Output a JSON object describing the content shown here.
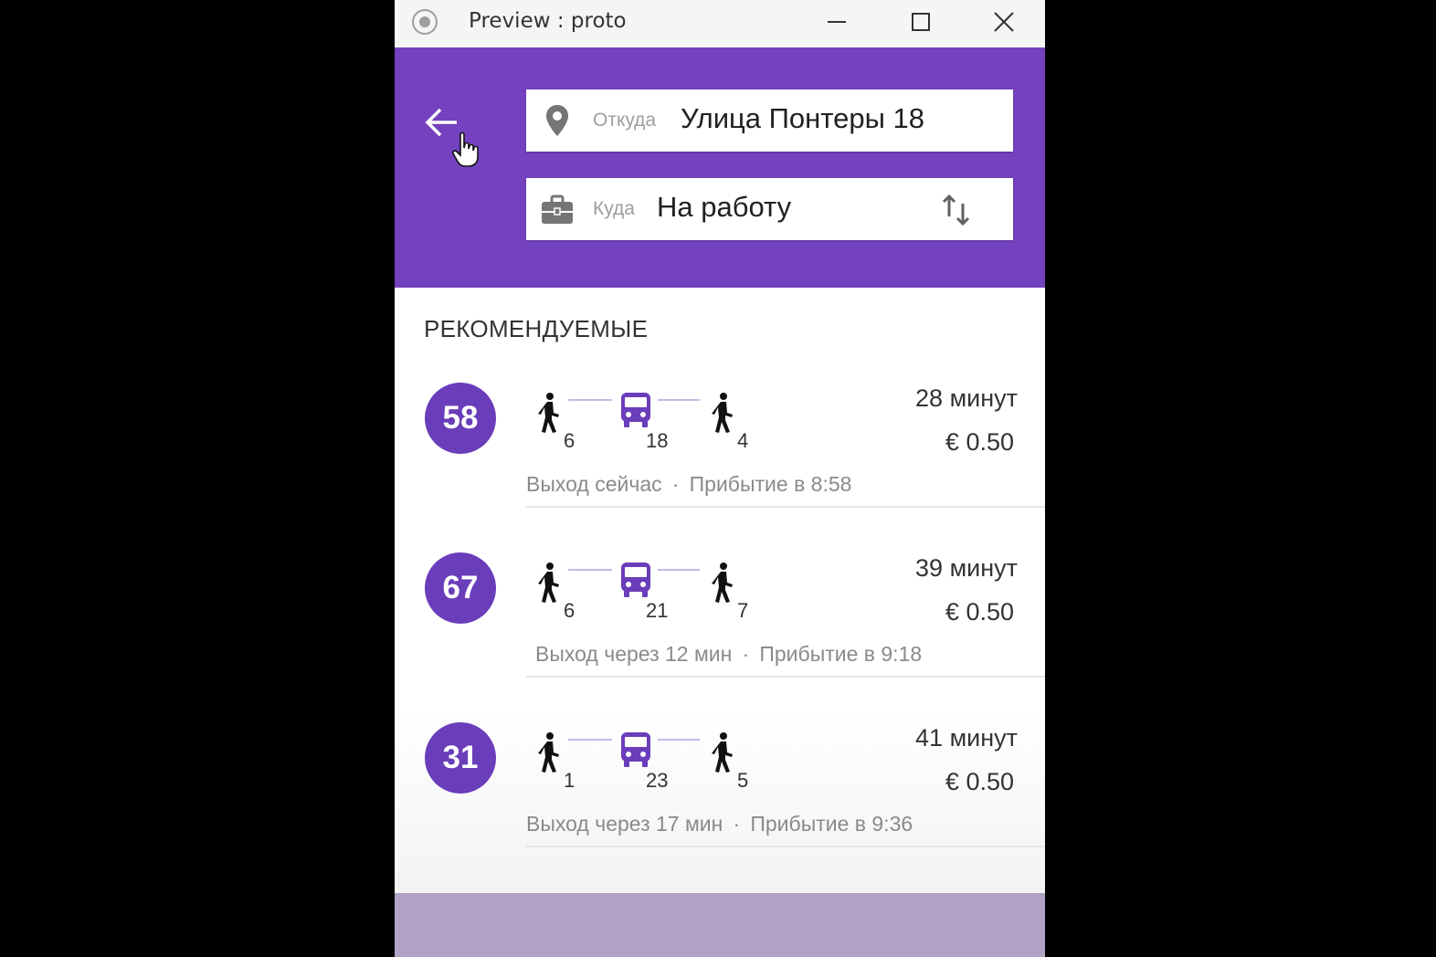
{
  "window": {
    "title": "Preview : proto"
  },
  "search": {
    "from_label": "Откуда",
    "from_value": "Улица Понтеры 18",
    "to_label": "Куда",
    "to_value": "На работу"
  },
  "section_title": "РЕКОМЕНДУЕМЫЕ",
  "routes": [
    {
      "number": "58",
      "walk_before": "6",
      "bus_ride": "18",
      "walk_after": "4",
      "duration": "28 минут",
      "price": "€ 0.50",
      "departure": "Выход сейчас",
      "separator": "·",
      "arrival": "Прибытие в 8:58"
    },
    {
      "number": "67",
      "walk_before": "6",
      "bus_ride": "21",
      "walk_after": "7",
      "duration": "39 минут",
      "price": "€ 0.50",
      "departure": "Выход через 12 мин",
      "separator": "·",
      "arrival": "Прибытие в 9:18"
    },
    {
      "number": "31",
      "walk_before": "1",
      "bus_ride": "23",
      "walk_after": "5",
      "duration": "41 минут",
      "price": "€ 0.50",
      "departure": "Выход через 17 мин",
      "separator": "·",
      "arrival": "Прибытие в 9:36"
    }
  ],
  "colors": {
    "header": "#7442bf",
    "badge": "#6a3dba",
    "bus_icon": "#6a3dba",
    "bottom_bar": "#b0a3c6"
  },
  "icons": {
    "back": "arrow-left-icon",
    "from": "location-pin-icon",
    "to": "briefcase-icon",
    "swap": "swap-vertical-icon",
    "walk": "walk-icon",
    "bus": "bus-icon"
  }
}
